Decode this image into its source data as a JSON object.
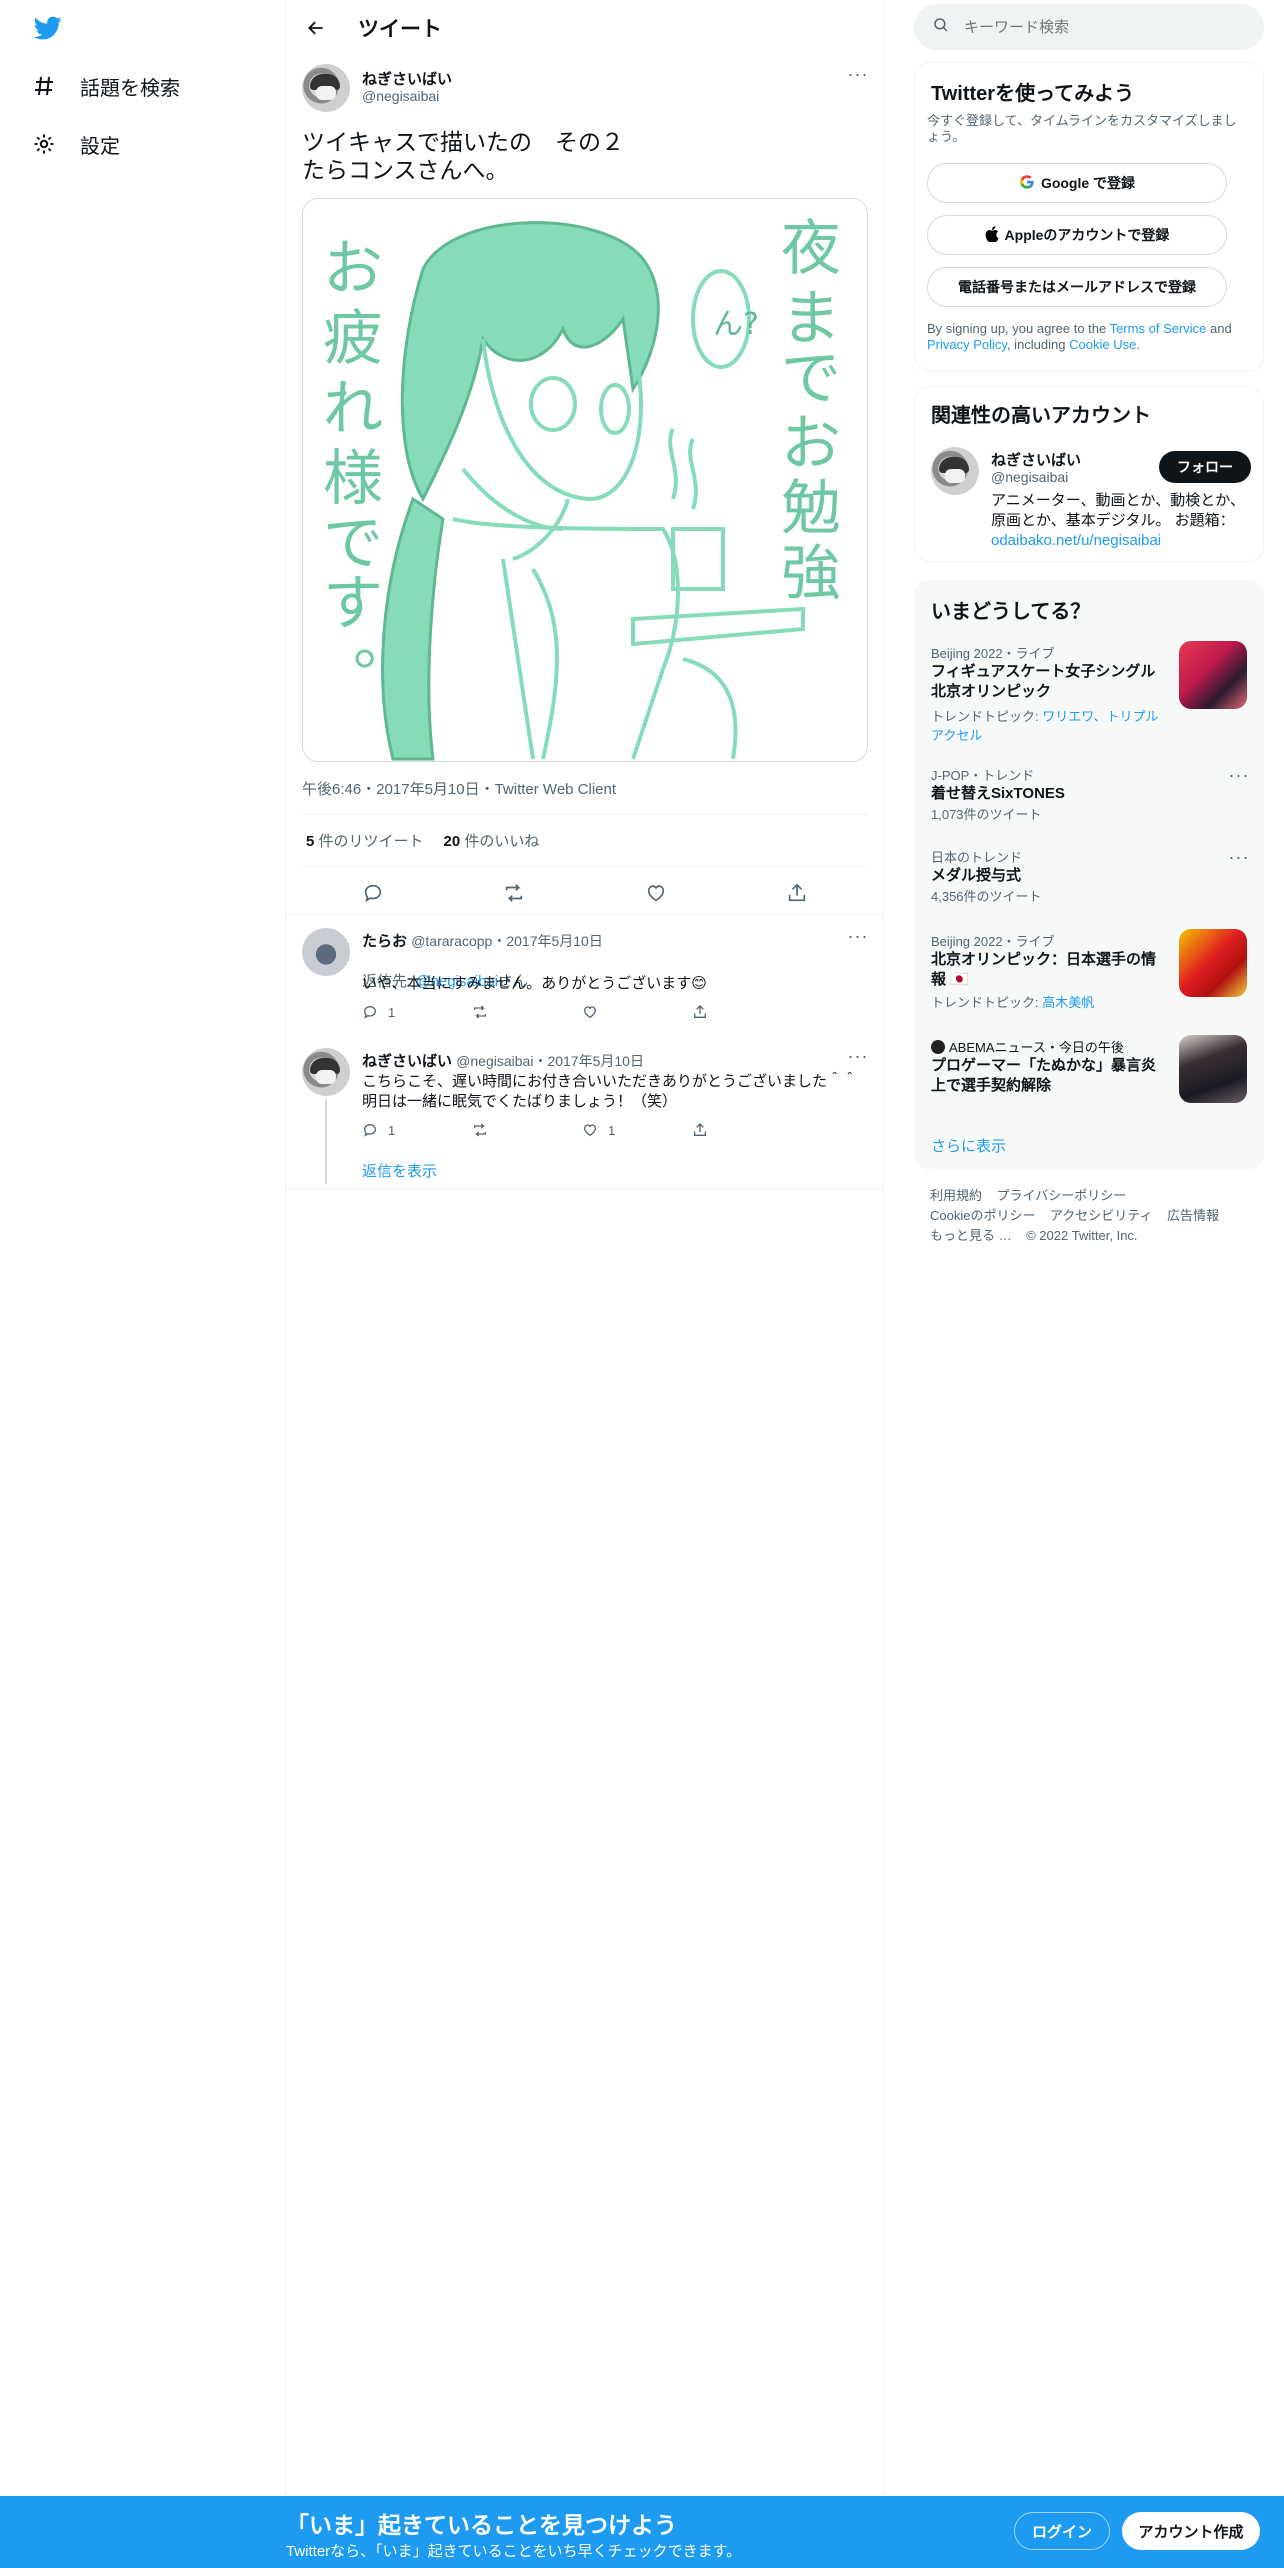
{
  "nav": {
    "explore_label": "話題を検索",
    "settings_label": "設定"
  },
  "header": {
    "title": "ツイート"
  },
  "tweet": {
    "name": "ねぎさいばい",
    "handle": "@negisaibai",
    "text": "ツイキャスで描いたの　その２\nたらコンスさんへ。",
    "meta": "午後6:46・2017年5月10日・Twitter Web Client",
    "retweets_count": "5",
    "retweets_label": "件のリツイート",
    "likes_count": "20",
    "likes_label": "件のいいね",
    "image_text_right": "夜までお勉強",
    "image_text_left": "お疲れ様です。",
    "image_bubble": "ん?"
  },
  "replies": [
    {
      "name": "たらお",
      "handle": "@tararacopp",
      "date": "・2017年5月10日",
      "reply_to_prefix": "返信先:",
      "reply_to_handle": "@negisaibai",
      "reply_to_suffix": "さん",
      "text": "いや、本当にすみません。ありがとうございます😊",
      "reply_count": "1",
      "like_count": ""
    },
    {
      "name": "ねぎさいばい",
      "handle": "@negisaibai",
      "date": "・2017年5月10日",
      "text": "こちらこそ、遅い時間にお付き合いいただきありがとうございました＾＾\n明日は一緒に眠気でくたばりましょう！（笑）",
      "reply_count": "1",
      "like_count": "1"
    }
  ],
  "show_replies": "返信を表示",
  "search": {
    "placeholder": "キーワード検索"
  },
  "signup": {
    "title": "Twitterを使ってみよう",
    "subtitle": "今すぐ登録して、タイムラインをカスタマイズしましょう。",
    "google": "Google で登録",
    "apple": "Appleのアカウントで登録",
    "phone": "電話番号またはメールアドレスで登録",
    "terms_prefix": "By signing up, you agree to the ",
    "terms_link": "Terms of Service",
    "terms_and": " and",
    "privacy_link": "Privacy Policy",
    "terms_including": ", including ",
    "cookie_link": "Cookie Use",
    "terms_end": "."
  },
  "related": {
    "title": "関連性の高いアカウント",
    "name": "ねぎさいばい",
    "handle": "@negisaibai",
    "follow": "フォロー",
    "bio": "アニメーター、動画とか、動検とか、原画とか、基本デジタル。 お題箱：",
    "bio_link": "odaibako.net/u/negisaibai"
  },
  "trends": {
    "title": "いまどうしてる？",
    "items": [
      {
        "context": "Beijing 2022・ライブ",
        "title": "フィギュアスケート女子シングル 北京オリンピック",
        "sub_prefix": "トレンドトピック: ",
        "sub_link": "ワリエワ、トリプルアクセル"
      },
      {
        "context": "J-POP・トレンド",
        "title": "着せ替えSixTONES",
        "sub": "1,073件のツイート"
      },
      {
        "context": "日本のトレンド",
        "title": "メダル授与式",
        "sub": "4,356件のツイート"
      },
      {
        "context": "Beijing 2022・ライブ",
        "title": "北京オリンピック：日本選手の情報 🇯🇵",
        "sub_prefix": "トレンドトピック: ",
        "sub_link": "高木美帆"
      },
      {
        "context": "ABEMAニュース・今日の午後",
        "title": "プロゲーマー「たぬかな」暴言炎上で選手契約解除"
      }
    ],
    "more": "さらに表示"
  },
  "footer": {
    "terms": "利用規約",
    "privacy": "プライバシーポリシー",
    "cookie": "Cookieのポリシー",
    "accessibility": "アクセシビリティ",
    "ads": "広告情報",
    "more": "もっと見る …",
    "copyright": "© 2022 Twitter, Inc."
  },
  "bottombar": {
    "title": "「いま」起きていることを見つけよう",
    "subtitle": "Twitterなら、「いま」起きていることをいち早くチェックできます。",
    "login": "ログイン",
    "signup": "アカウント作成"
  },
  "colors": {
    "accent": "#1d9bf0",
    "illustration": "#86dcb8"
  }
}
